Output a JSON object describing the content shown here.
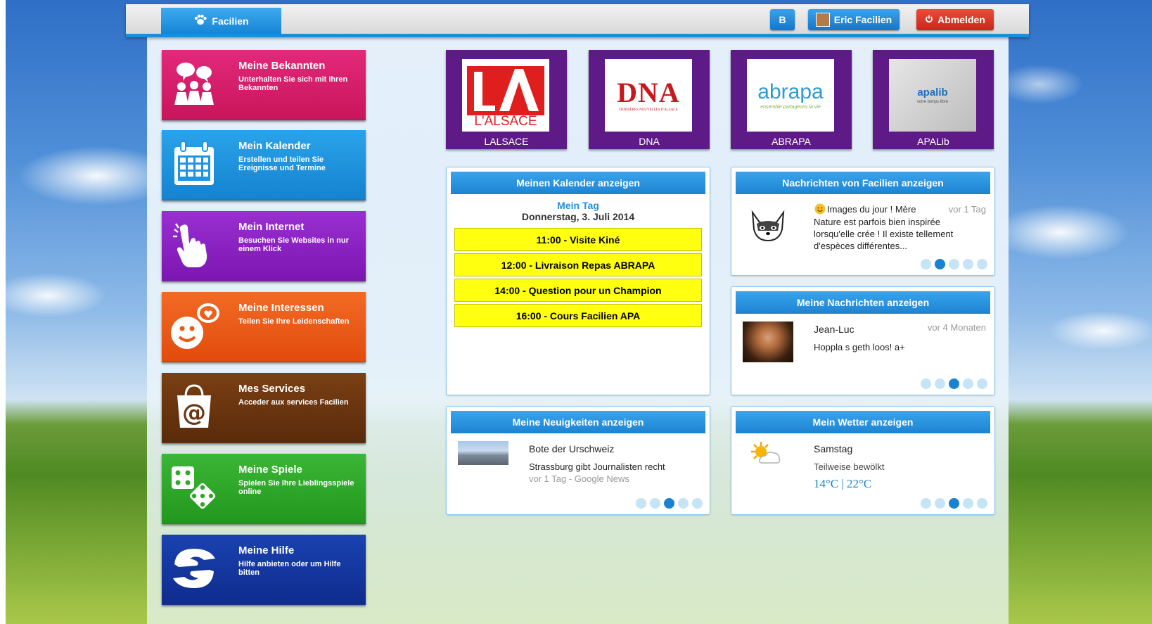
{
  "header": {
    "brand": "Facilien",
    "b_label": "B",
    "user_name": "Eric Facilien",
    "logout_label": "Abmelden"
  },
  "tiles": [
    {
      "title": "Meine Bekannten",
      "desc": "Unterhalten Sie sich mit Ihren Bekannten",
      "color": "#d81e6a",
      "icon": "people-chat-icon"
    },
    {
      "title": "Mein Kalender",
      "desc": "Erstellen und teilen Sie Ereignisse und Termine",
      "color": "#1d95e0",
      "icon": "calendar-icon"
    },
    {
      "title": "Mein Internet",
      "desc": "Besuchen Sie Websites in nur einem Klick",
      "color": "#8a22c0",
      "icon": "pointing-hand-icon"
    },
    {
      "title": "Meine Interessen",
      "desc": "Teilen Sie Ihre Leidenschaften",
      "color": "#ee5a16",
      "icon": "smiley-heart-icon"
    },
    {
      "title": "Mes Services",
      "desc": "Acceder aux services Facilien",
      "color": "#6a3510",
      "icon": "shopping-bag-at-icon"
    },
    {
      "title": "Meine Spiele",
      "desc": "Spielen Sie Ihre Lieblingsspiele online",
      "color": "#2fa82a",
      "icon": "dice-icon"
    },
    {
      "title": "Meine Hilfe",
      "desc": "Hilfe anbieten oder um Hilfe bitten",
      "color": "#13359e",
      "icon": "helping-hands-icon"
    }
  ],
  "partners": [
    {
      "name": "LALSACE",
      "logo_text": "L'ALSACE"
    },
    {
      "name": "DNA",
      "logo_text": "DNA",
      "logo_sub": "DERNIÈRES NOUVELLES D'ALSACE"
    },
    {
      "name": "ABRAPA",
      "logo_text": "abrapa",
      "logo_sub": "ensemble partageons la vie"
    },
    {
      "name": "APALib",
      "logo_text": "apalib",
      "logo_sub": "votre temps libre"
    }
  ],
  "calendar": {
    "header": "Meinen Kalender anzeigen",
    "subtitle": "Mein Tag",
    "date": "Donnerstag, 3. Juli 2014",
    "events": [
      "11:00 - Visite Kiné",
      "12:00 - Livraison Repas ABRAPA",
      "14:00 - Question pour un Champion",
      "16:00 - Cours Facilien APA"
    ]
  },
  "facilien_news": {
    "header": "Nachrichten von Facilien anzeigen",
    "title": "Images du jour ! Mère",
    "time": "vor 1 Tag",
    "text": "Nature est parfois bien inspirée lorsqu'elle crée ! Il existe tellement d'espèces différentes...",
    "active_dot": 2
  },
  "messages": {
    "header": "Meine Nachrichten anzeigen",
    "sender": "Jean-Luc",
    "time": "vor 4 Monaten",
    "text": "Hoppla s geth loos! a+",
    "active_dot": 3
  },
  "news": {
    "header": "Meine Neuigkeiten anzeigen",
    "source": "Bote der Urschweiz",
    "headline": "Strassburg gibt Journalisten recht",
    "meta": "vor 1 Tag - Google News",
    "active_dot": 3
  },
  "weather": {
    "header": "Mein Wetter anzeigen",
    "day": "Samstag",
    "condition": "Teilweise bewölkt",
    "temps": "14°C | 22°C",
    "active_dot": 3
  },
  "colors": {
    "header_blue": "#1a8fd8",
    "logout_red": "#d32f22",
    "event_yellow": "#ffff10",
    "partner_purple": "#5e1a87"
  }
}
